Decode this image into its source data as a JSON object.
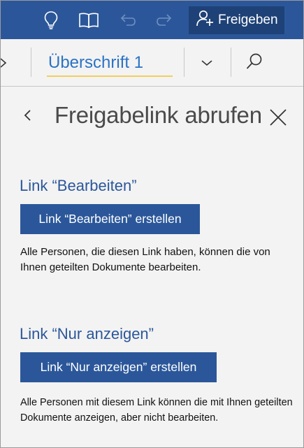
{
  "toolbar": {
    "share_label": "Freigeben",
    "icons": [
      "lightbulb-icon",
      "book-icon",
      "undo-icon",
      "redo-icon",
      "add-person-icon"
    ]
  },
  "ribbon": {
    "style_value": "Überschrift 1",
    "icons": [
      "chevron-left-icon",
      "chevron-down-icon",
      "search-icon"
    ]
  },
  "pane": {
    "title": "Freigabelink abrufen",
    "edit_section": {
      "title": "Link “Bearbeiten”",
      "button_label": "Link “Bearbeiten” erstellen",
      "description": "Alle Personen, die diesen Link haben, können die von Ihnen geteilten Dokumente bearbeiten."
    },
    "view_section": {
      "title": "Link “Nur anzeigen”",
      "button_label": "Link “Nur anzeigen” erstellen",
      "description": "Alle Personen mit diesem Link können die mit Ihnen geteilten Dokumente anzeigen, aber nicht bearbeiten."
    }
  },
  "colors": {
    "brand": "#2b579a",
    "share_button": "#1e4277",
    "style_text": "#2b73c4",
    "style_underline": "#f2cf5b"
  }
}
